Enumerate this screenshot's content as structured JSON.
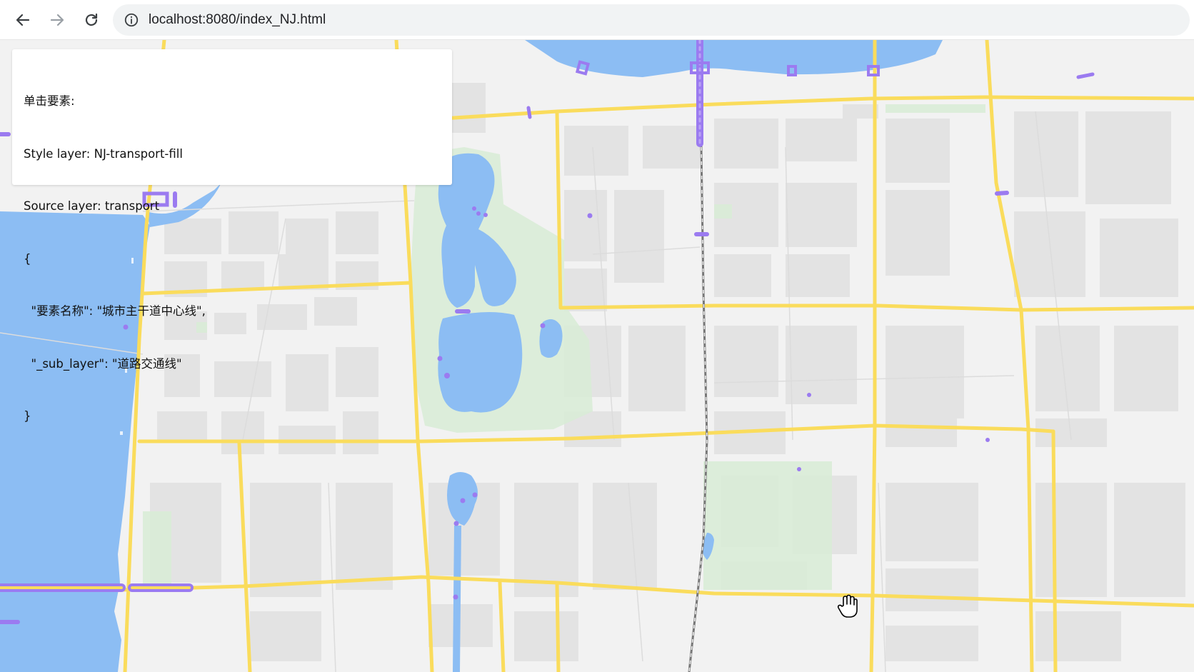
{
  "browser": {
    "url": "localhost:8080/index_NJ.html",
    "back_icon": "arrow-left-icon",
    "forward_icon": "arrow-right-icon",
    "reload_icon": "reload-icon",
    "info_icon": "info-circle-icon"
  },
  "popup": {
    "line1": "单击要素:",
    "line2": "Style layer: NJ-transport-fill",
    "line3": "Source layer: transport",
    "line4": "{",
    "line5": "  \"要素名称\": \"城市主干道中心线\",",
    "line6": "  \"_sub_layer\": \"道路交通线\"",
    "line7": "}"
  },
  "map": {
    "colors": {
      "background": "#f2f2f2",
      "water": "#8cbdf3",
      "park": "#d8ecd6",
      "road_major": "#fadc5c",
      "transport_highlight": "#9b7bf0",
      "building": "#e2e2e2"
    },
    "cursor_icon": "hand-pointer-icon"
  }
}
